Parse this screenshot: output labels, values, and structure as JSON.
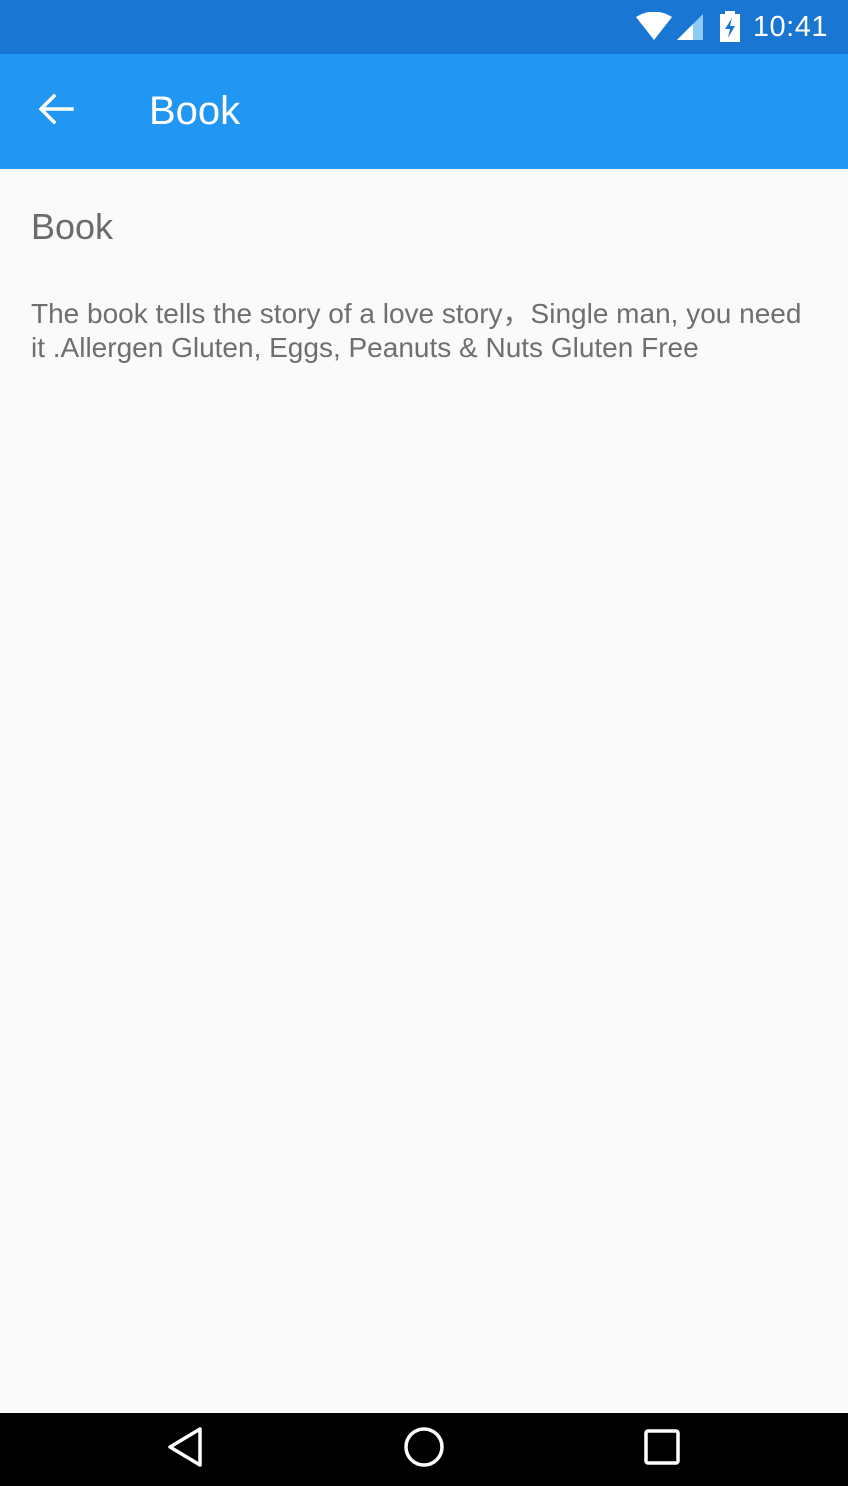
{
  "status_bar": {
    "time": "10:41",
    "icons": [
      "wifi-icon",
      "signal-icon",
      "battery-charging-icon"
    ]
  },
  "app_bar": {
    "title": "Book",
    "back_icon": "arrow-back-icon"
  },
  "content": {
    "title": "Book",
    "description": "The book tells the story of a love story，Single man, you need it .Allergen Gluten, Eggs, Peanuts & Nuts Gluten Free"
  },
  "nav_bar": {
    "buttons": [
      "back-triangle-icon",
      "home-circle-icon",
      "recents-square-icon"
    ]
  },
  "colors": {
    "status_bar": "#1976d2",
    "app_bar": "#2196f3",
    "background": "#fafafa",
    "text": "#6b6b6b"
  }
}
